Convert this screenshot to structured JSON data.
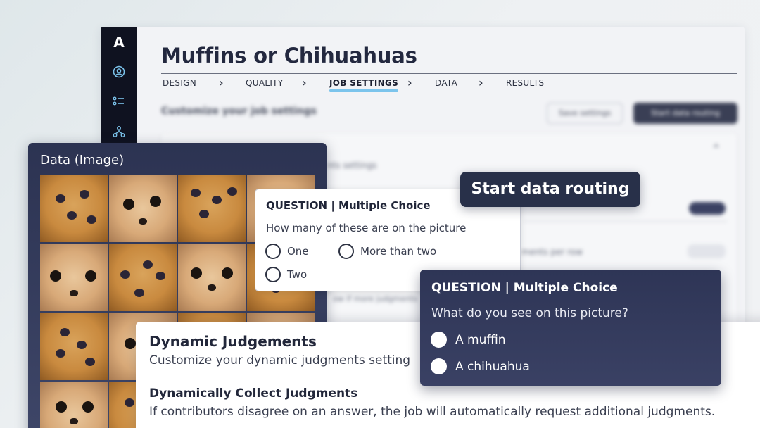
{
  "app": {
    "logo": "A",
    "title": "Muffins or Chihuahuas",
    "steps": [
      "DESIGN",
      "QUALITY",
      "JOB SETTINGS",
      "DATA",
      "RESULTS"
    ],
    "active_step": "JOB SETTINGS",
    "rail_icons": [
      "user-circle-icon",
      "list-icon",
      "hierarchy-icon"
    ]
  },
  "background": {
    "subtitle": "Customize your job settings",
    "save_button": "Save settings",
    "start_button": "Start data routing",
    "section_text": "nts settings",
    "row_text": "ments per row",
    "row_text_2": "ow if more judgments"
  },
  "data_panel": {
    "title": "Data (Image)"
  },
  "question_1": {
    "header": "QUESTION | Multiple Choice",
    "text": "How many of these are on the picture",
    "options": [
      "One",
      "More than two",
      "Two"
    ]
  },
  "start_routing": {
    "label": "Start data routing"
  },
  "dynamic_judgements": {
    "title": "Dynamic Judgements",
    "subtitle": "Customize your dynamic judgments setting",
    "collect_title": "Dynamically Collect Judgments",
    "collect_text": "If contributors disagree on an answer, the job will automatically request additional judgments."
  },
  "question_2": {
    "header": "QUESTION | Multiple Choice",
    "text": "What do you see on this picture?",
    "options": [
      "A muffin",
      "A chihuahua"
    ]
  },
  "colors": {
    "navy": "#283049",
    "accent_underline": "#7cc4ec",
    "rail_icon": "#7cc4ec"
  }
}
